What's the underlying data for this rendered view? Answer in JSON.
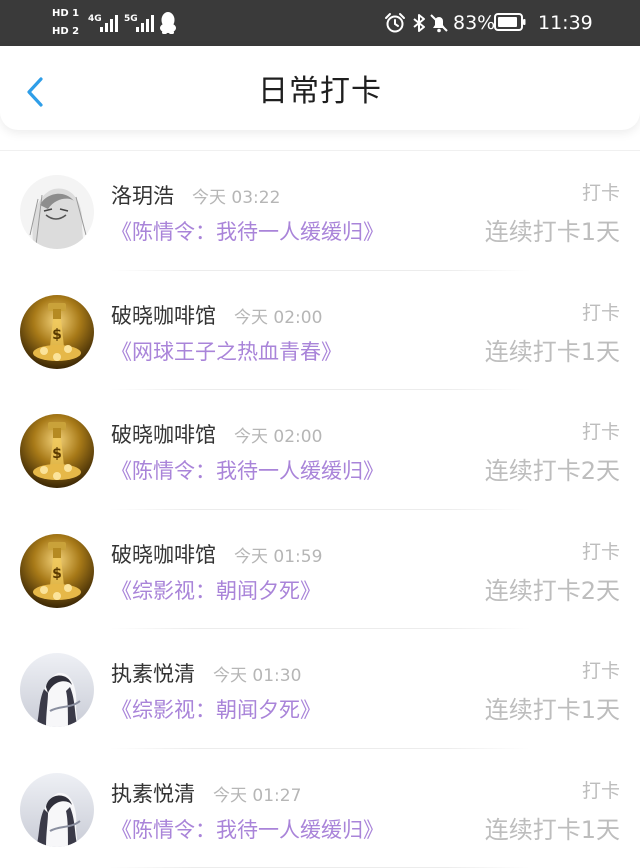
{
  "status_bar": {
    "hd1": "HD 1",
    "hd2": "HD 2",
    "net1": "4G",
    "net2": "5G",
    "battery_percent": "83%",
    "time": "11:39",
    "icons": [
      "qq-icon",
      "alarm-icon",
      "bluetooth-icon",
      "mute-icon",
      "battery-icon"
    ]
  },
  "header": {
    "title": "日常打卡",
    "back_icon": "chevron-left-icon",
    "accent_color": "#2f9ee8"
  },
  "colors": {
    "book_title": "#a984d9",
    "muted": "#bdbdbd",
    "status_bar_bg": "#3a3a3a"
  },
  "checkins": [
    {
      "user": "洛玥浩",
      "time": "今天 03:22",
      "tag": "打卡",
      "book": "《陈情令：我待一人缓缓归》",
      "streak": "连续打卡1天",
      "avatar": "sketch-portrait"
    },
    {
      "user": "破晓咖啡馆",
      "time": "今天 02:00",
      "tag": "打卡",
      "book": "《网球王子之热血青春》",
      "streak": "连续打卡1天",
      "avatar": "gold-coins"
    },
    {
      "user": "破晓咖啡馆",
      "time": "今天 02:00",
      "tag": "打卡",
      "book": "《陈情令：我待一人缓缓归》",
      "streak": "连续打卡2天",
      "avatar": "gold-coins"
    },
    {
      "user": "破晓咖啡馆",
      "time": "今天 01:59",
      "tag": "打卡",
      "book": "《综影视：朝闻夕死》",
      "streak": "连续打卡2天",
      "avatar": "gold-coins"
    },
    {
      "user": "执素悦清",
      "time": "今天 01:30",
      "tag": "打卡",
      "book": "《综影视：朝闻夕死》",
      "streak": "连续打卡1天",
      "avatar": "ink-character"
    },
    {
      "user": "执素悦清",
      "time": "今天 01:27",
      "tag": "打卡",
      "book": "《陈情令：我待一人缓缓归》",
      "streak": "连续打卡1天",
      "avatar": "ink-character"
    }
  ]
}
